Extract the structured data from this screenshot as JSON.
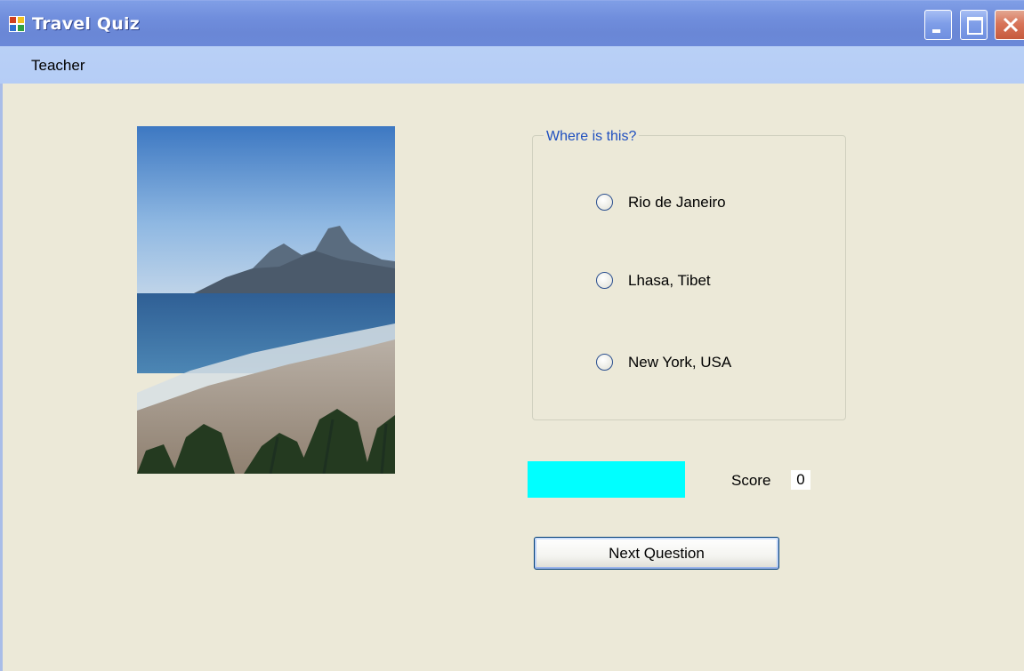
{
  "window": {
    "title": "Travel Quiz",
    "controls": [
      "minimize",
      "maximize",
      "close"
    ]
  },
  "menu": {
    "items": [
      {
        "label": "Teacher"
      }
    ]
  },
  "photo": {
    "icon": "photo-beach-mountains"
  },
  "question": {
    "prompt": "Where is this?",
    "options": [
      {
        "label": "Rio de Janeiro",
        "selected": false
      },
      {
        "label": "Lhasa, Tibet",
        "selected": false
      },
      {
        "label": "New York, USA",
        "selected": false
      }
    ]
  },
  "feedback": {
    "color": "#00ffff"
  },
  "score": {
    "label": "Score",
    "value": "0"
  },
  "actions": {
    "next_label": "Next Question"
  },
  "colors": {
    "titlebar": "#6a87d6",
    "menubar": "#b7cef6",
    "window_bg": "#ece9d8",
    "legend_text": "#1f4fbf"
  }
}
